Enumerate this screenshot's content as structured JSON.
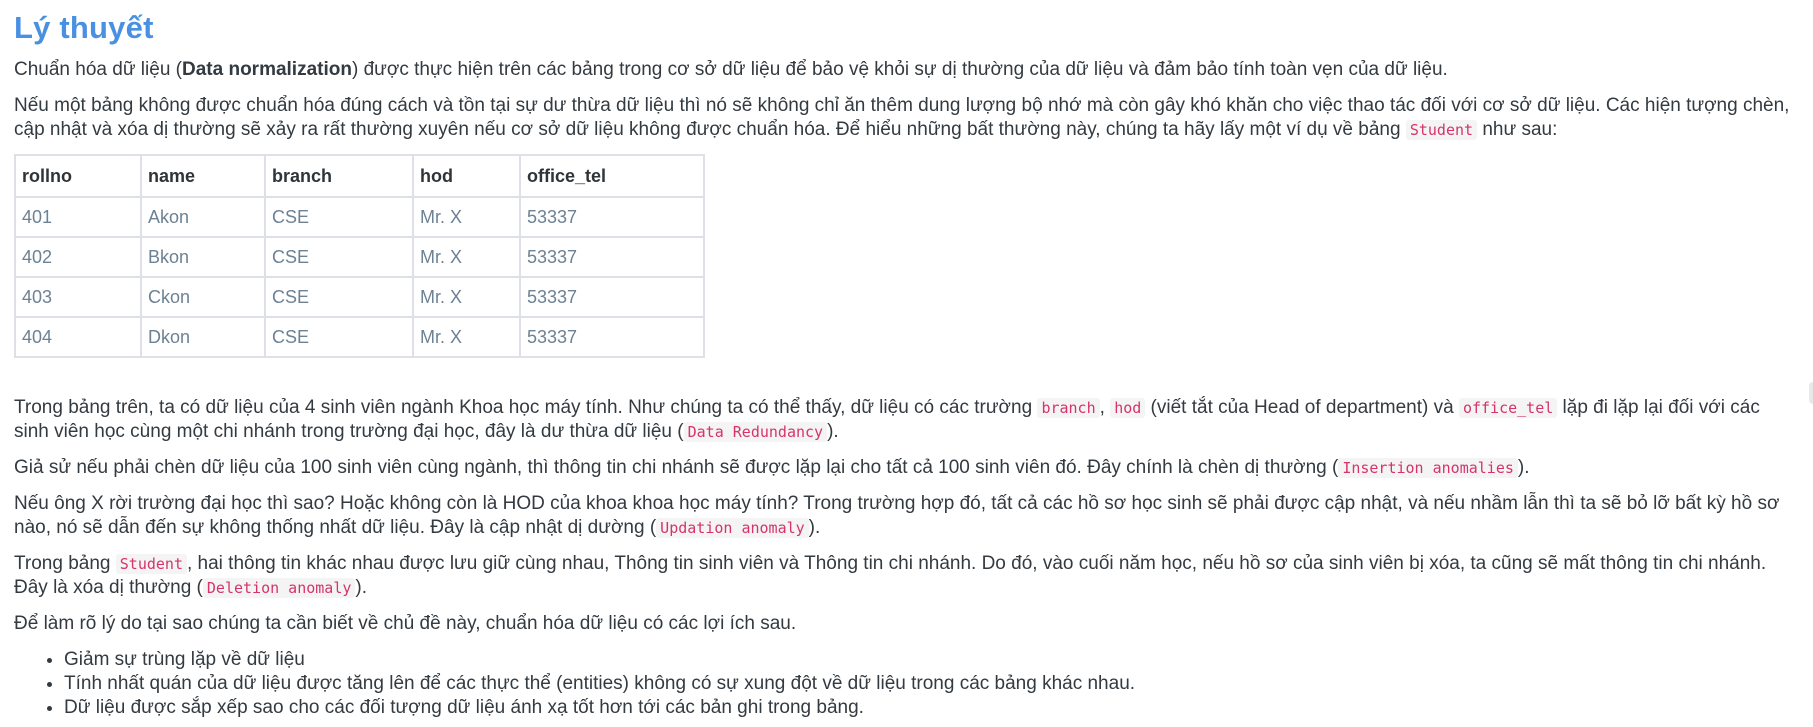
{
  "title": "Lý thuyết",
  "intro": {
    "before": "Chuẩn hóa dữ liệu (",
    "bold": "Data normalization",
    "after": ") được thực hiện trên các bảng trong cơ sở dữ liệu để bảo vệ khỏi sự dị thường của dữ liệu và đảm bảo tính toàn vẹn của dữ liệu."
  },
  "p2": {
    "before": "Nếu một bảng không được chuẩn hóa đúng cách và tồn tại sự dư thừa dữ liệu thì nó sẽ không chỉ ăn thêm dung lượng bộ nhớ mà còn gây khó khăn cho việc thao tác đối với cơ sở dữ liệu. Các hiện tượng chèn, cập nhật và xóa dị thường sẽ xảy ra rất thường xuyên nếu cơ sở dữ liệu không được chuẩn hóa. Để hiểu những bất thường này, chúng ta hãy lấy một ví dụ về bảng ",
    "code": "Student",
    "after": " như sau:"
  },
  "table": {
    "headers": [
      "rollno",
      "name",
      "branch",
      "hod",
      "office_tel"
    ],
    "rows": [
      [
        "401",
        "Akon",
        "CSE",
        "Mr. X",
        "53337"
      ],
      [
        "402",
        "Bkon",
        "CSE",
        "Mr. X",
        "53337"
      ],
      [
        "403",
        "Ckon",
        "CSE",
        "Mr. X",
        "53337"
      ],
      [
        "404",
        "Dkon",
        "CSE",
        "Mr. X",
        "53337"
      ]
    ]
  },
  "p3": {
    "t1": "Trong bảng trên, ta có dữ liệu của 4 sinh viên ngành Khoa học máy tính. Như chúng ta có thể thấy, dữ liệu có các trường ",
    "c1": "branch",
    "t2": ", ",
    "c2": "hod",
    "t3": " (viết tắt của Head of department) và ",
    "c3": "office_tel",
    "t4": " lặp đi lặp lại đối với các sinh viên học cùng một chi nhánh trong trường đại học, đây là dư thừa dữ liệu (",
    "c4": "Data Redundancy",
    "t5": ")."
  },
  "p4": {
    "before": "Giả sử nếu phải chèn dữ liệu của 100 sinh viên cùng ngành, thì thông tin chi nhánh sẽ được lặp lại cho tất cả 100 sinh viên đó. Đây chính là chèn dị thường (",
    "code": "Insertion anomalies",
    "after": ")."
  },
  "p5": {
    "before": "Nếu ông X rời trường đại học thì sao? Hoặc không còn là HOD của khoa khoa học máy tính? Trong trường hợp đó, tất cả các hồ sơ học sinh sẽ phải được cập nhật, và nếu nhầm lẫn thì ta sẽ bỏ lỡ bất kỳ hồ sơ nào, nó sẽ dẫn đến sự không thống nhất dữ liệu. Đây là cập nhật dị dường (",
    "code": "Updation anomaly",
    "after": ")."
  },
  "p6": {
    "before": "Trong bảng ",
    "code1": "Student",
    "middle": ", hai thông tin khác nhau được lưu giữ cùng nhau, Thông tin sinh viên và Thông tin chi nhánh. Do đó, vào cuối năm học, nếu hồ sơ của sinh viên bị xóa, ta cũng sẽ mất thông tin chi nhánh. Đây là xóa dị thường (",
    "code2": "Deletion anomaly",
    "after": ")."
  },
  "p7": "Để làm rõ lý do tại sao chúng ta cần biết về chủ đề này, chuẩn hóa dữ liệu có các lợi ích sau.",
  "benefits": [
    "Giảm sự trùng lặp về dữ liệu",
    "Tính nhất quán của dữ liệu được tăng lên để các thực thể (entities) không có sự  xung đột về dữ liệu trong các bảng khác nhau.",
    "Dữ liệu được sắp xếp sao cho các đối tượng dữ liệu ánh xạ tốt hơn tới các bản ghi trong bảng."
  ]
}
